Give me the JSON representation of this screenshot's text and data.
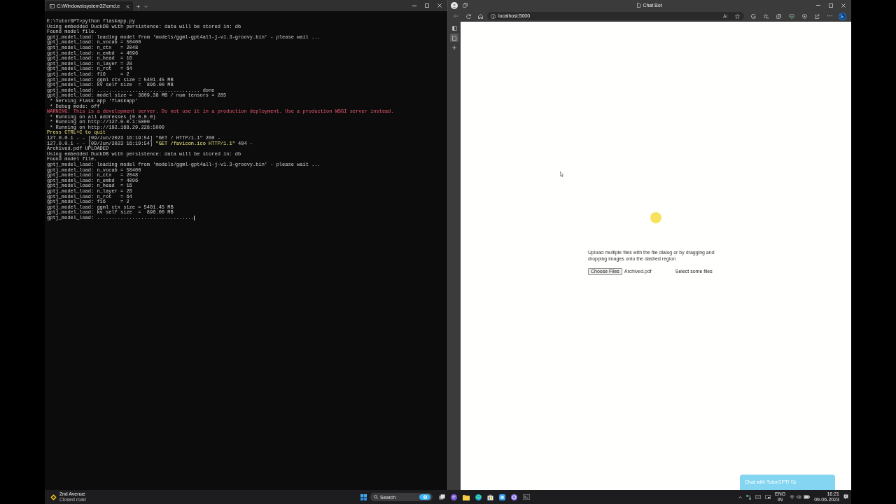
{
  "terminal": {
    "tab_title": "C:\\Windows\\system32\\cmd.e",
    "lines": [
      {
        "kind": "plain",
        "text": "E:\\TutorGPT>python flaskapp.py"
      },
      {
        "kind": "plain",
        "text": "Using embedded DuckDB with persistence: data will be stored in: db"
      },
      {
        "kind": "plain",
        "text": "Found model file."
      },
      {
        "kind": "plain",
        "text": "gptj_model_load: loading model from 'models/ggml-gpt4all-j-v1.3-groovy.bin' - please wait ..."
      },
      {
        "kind": "plain",
        "text": "gptj_model_load: n_vocab = 50400"
      },
      {
        "kind": "plain",
        "text": "gptj_model_load: n_ctx   = 2048"
      },
      {
        "kind": "plain",
        "text": "gptj_model_load: n_embd  = 4096"
      },
      {
        "kind": "plain",
        "text": "gptj_model_load: n_head  = 16"
      },
      {
        "kind": "plain",
        "text": "gptj_model_load: n_layer = 28"
      },
      {
        "kind": "plain",
        "text": "gptj_model_load: n_rot   = 64"
      },
      {
        "kind": "plain",
        "text": "gptj_model_load: f16     = 2"
      },
      {
        "kind": "plain",
        "text": "gptj_model_load: ggml ctx size = 5401.45 MB"
      },
      {
        "kind": "plain",
        "text": "gptj_model_load: kv self size  =  896.00 MB"
      },
      {
        "kind": "plain",
        "text": "gptj_model_load: ................................... done"
      },
      {
        "kind": "plain",
        "text": "gptj_model_load: model size =  3609.38 MB / num tensors = 285"
      },
      {
        "kind": "plain",
        "text": " * Serving Flask app 'flaskapp'"
      },
      {
        "kind": "plain",
        "text": " * Debug mode: off"
      },
      {
        "kind": "warning",
        "text": "WARNING: This is a development server. Do not use it in a production deployment. Use a production WSGI server instead."
      },
      {
        "kind": "plain",
        "text": " * Running on all addresses (0.0.0.0)"
      },
      {
        "kind": "plain",
        "text": " * Running on http://127.0.0.1:5000"
      },
      {
        "kind": "plain",
        "text": " * Running on http://192.168.29.228:5000"
      },
      {
        "kind": "notice",
        "text": "Press CTRL+C to quit"
      },
      {
        "kind": "plain",
        "text": "127.0.0.1 - - [09/Jun/2023 16:19:54] \"GET / HTTP/1.1\" 200 -"
      },
      {
        "kind": "mixed",
        "parts": [
          {
            "kind": "plain",
            "text": "127.0.0.1 - - [09/Jun/2023 16:19:54] "
          },
          {
            "kind": "notice",
            "text": "\"GET /favicon.ico HTTP/1.1\""
          },
          {
            "kind": "plain",
            "text": " 404 -"
          }
        ]
      },
      {
        "kind": "plain",
        "text": "Archived.pdf UPLOADED"
      },
      {
        "kind": "plain",
        "text": "Using embedded DuckDB with persistence: data will be stored in: db"
      },
      {
        "kind": "plain",
        "text": "Found model file."
      },
      {
        "kind": "plain",
        "text": "gptj_model_load: loading model from 'models/ggml-gpt4all-j-v1.3-groovy.bin' - please wait ..."
      },
      {
        "kind": "plain",
        "text": "gptj_model_load: n_vocab = 50400"
      },
      {
        "kind": "plain",
        "text": "gptj_model_load: n_ctx   = 2048"
      },
      {
        "kind": "plain",
        "text": "gptj_model_load: n_embd  = 4096"
      },
      {
        "kind": "plain",
        "text": "gptj_model_load: n_head  = 16"
      },
      {
        "kind": "plain",
        "text": "gptj_model_load: n_layer = 28"
      },
      {
        "kind": "plain",
        "text": "gptj_model_load: n_rot   = 64"
      },
      {
        "kind": "plain",
        "text": "gptj_model_load: f16     = 2"
      },
      {
        "kind": "plain",
        "text": "gptj_model_load: ggml ctx size = 5401.45 MB"
      },
      {
        "kind": "plain",
        "text": "gptj_model_load: kv self size  =  896.00 MB"
      },
      {
        "kind": "plain",
        "text": "gptj_model_load: ................................."
      }
    ]
  },
  "browser": {
    "title": "Chat Bot",
    "address": "localhost:5000",
    "sidebar_tabs": [
      {
        "selected": true
      }
    ],
    "page": {
      "description": "Upload multiple files with the file dialog or by dragging and dropping images onto the dashed region",
      "choose_button": "Choose Files",
      "file_name": "Archived.pdf",
      "status": "Select some files",
      "chat_button": "Chat with TutorGPT!"
    }
  },
  "taskbar": {
    "weather": {
      "title": "2nd Avenue",
      "subtitle": "Closed road"
    },
    "search": {
      "placeholder": "Search"
    },
    "tray": {
      "language": "ENG",
      "region": "IN",
      "time": "16:21",
      "date": "09-06-2023"
    }
  }
}
